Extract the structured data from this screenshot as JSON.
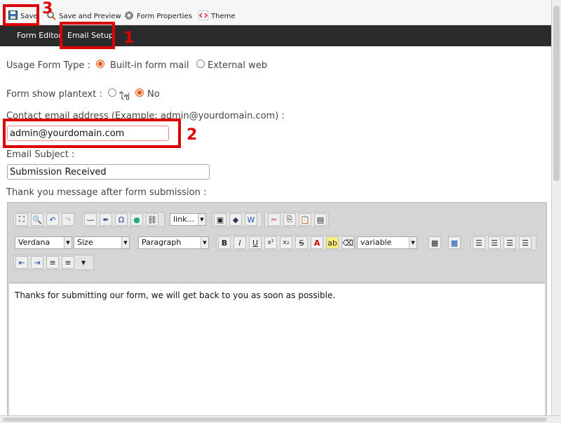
{
  "toolbar": {
    "save": "Save",
    "save_preview": "Save and Preview",
    "form_properties": "Form Properties",
    "theme": "Theme"
  },
  "nav": {
    "form_editor": "Form Editor",
    "email_setup": "Email Setup"
  },
  "annotations": {
    "n1": "1",
    "n2": "2",
    "n3": "3"
  },
  "form": {
    "usage_label": "Usage Form Type :",
    "usage_opt1": "Built-in form mail",
    "usage_opt2": "External web",
    "plaintext_label": "Form show plantext :",
    "plaintext_yes": "ใช่",
    "plaintext_no": "No",
    "contact_label": "Contact email address (Example: admin@yourdomain.com) :",
    "contact_value": "admin@yourdomain.com",
    "subject_label": "Email Subject :",
    "subject_value": "Submission Received",
    "thanks_label": "Thank you message after form submission :"
  },
  "editor": {
    "link_select": "link...",
    "font_select": "Verdana",
    "size_select": "Size",
    "format_select": "Paragraph",
    "variable_select": "variable",
    "body_text": "Thanks for submitting our form, we will get back to you as soon as possible."
  },
  "colors": {
    "annotation": "#dd0000",
    "radio_checked": "#e06020",
    "nav_bg": "#2b2b2b"
  }
}
